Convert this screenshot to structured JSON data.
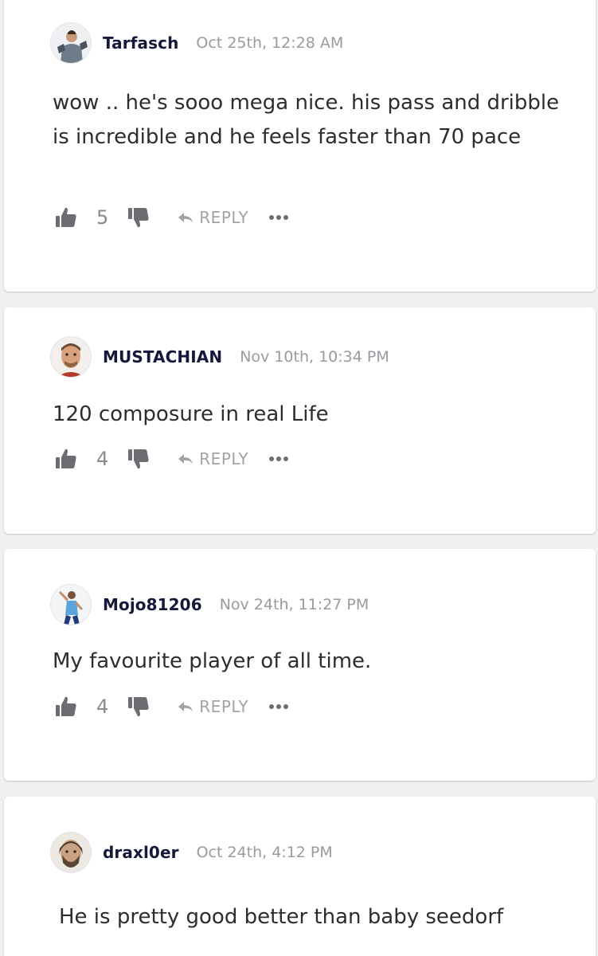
{
  "comments": [
    {
      "username": "Tarfasch",
      "timestamp": "Oct 25th, 12:28 AM",
      "text": "wow .. he's sooo mega nice. his pass and dribble is incredible and he feels faster than 70 pace",
      "likes": "5",
      "reply_label": "REPLY",
      "avatar_icon": "goalkeeper-avatar"
    },
    {
      "username": "MUSTACHIAN",
      "timestamp": "Nov 10th, 10:34 PM",
      "text": "120 composure in real Life",
      "likes": "4",
      "reply_label": "REPLY",
      "avatar_icon": "player-face-avatar"
    },
    {
      "username": "Mojo81206",
      "timestamp": "Nov 24th, 11:27 PM",
      "text": "My favourite player of all time.",
      "likes": "4",
      "reply_label": "REPLY",
      "avatar_icon": "player-celebrating-avatar"
    },
    {
      "username": "draxl0er",
      "timestamp": "Oct 24th, 4:12 PM",
      "text": "He is pretty good better than baby seedorf",
      "avatar_icon": "bearded-player-avatar"
    }
  ],
  "colors": {
    "username": "#15183a",
    "timestamp": "#9a9aa0",
    "action_icon": "#6c6c72",
    "background": "#f0f0f0",
    "card": "#ffffff"
  }
}
